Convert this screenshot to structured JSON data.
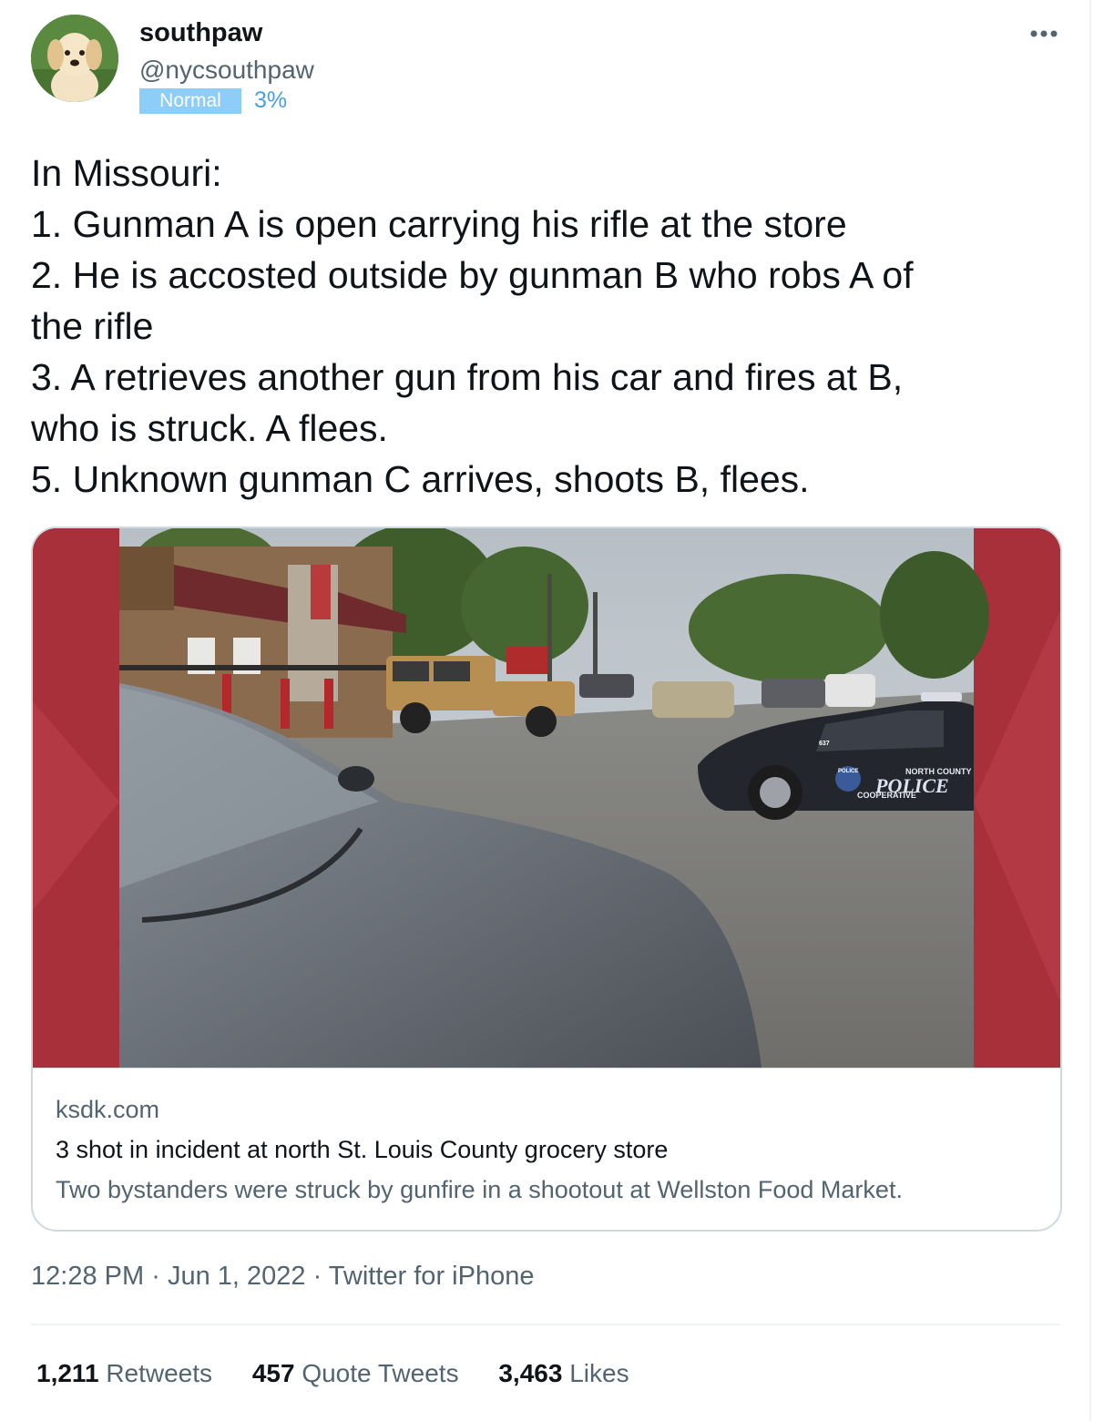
{
  "author": {
    "display_name": "southpaw",
    "handle": "@nycsouthpaw",
    "badge_label": "Normal",
    "badge_percent": "3%",
    "avatar_icon": "puppy-avatar"
  },
  "tweet": {
    "lines": [
      "In Missouri:",
      "1. Gunman A is open carrying his rifle at the store",
      "2. He is accosted outside by gunman B who robs A of",
      "the rifle",
      "3. A retrieves another gun from his car and fires at B,",
      "who is struck. A flees.",
      "5. Unknown gunman C arrives, shoots B, flees."
    ]
  },
  "card": {
    "domain": "ksdk.com",
    "title": "3 shot in incident at north St. Louis County grocery store",
    "description": "Two bystanders were struck by gunfire in a shootout at Wellston Food Market.",
    "image_text": {
      "police_word": "POLICE",
      "police_top": "NORTH COUNTY",
      "police_bottom": "COOPERATIVE",
      "badge": "POLICE",
      "unit": "637"
    }
  },
  "meta": {
    "time": "12:28 PM",
    "separator": "·",
    "date": "Jun 1, 2022",
    "source": "Twitter for iPhone"
  },
  "stats": {
    "retweets_count": "1,211",
    "retweets_label": "Retweets",
    "quotes_count": "457",
    "quotes_label": "Quote Tweets",
    "likes_count": "3,463",
    "likes_label": "Likes"
  },
  "colors": {
    "text": "#0f1419",
    "secondary": "#536471",
    "badge_bg": "#8ecdf8",
    "percent": "#4a9fe0",
    "card_border": "#cfd9de",
    "card_side": "#a8303a"
  }
}
